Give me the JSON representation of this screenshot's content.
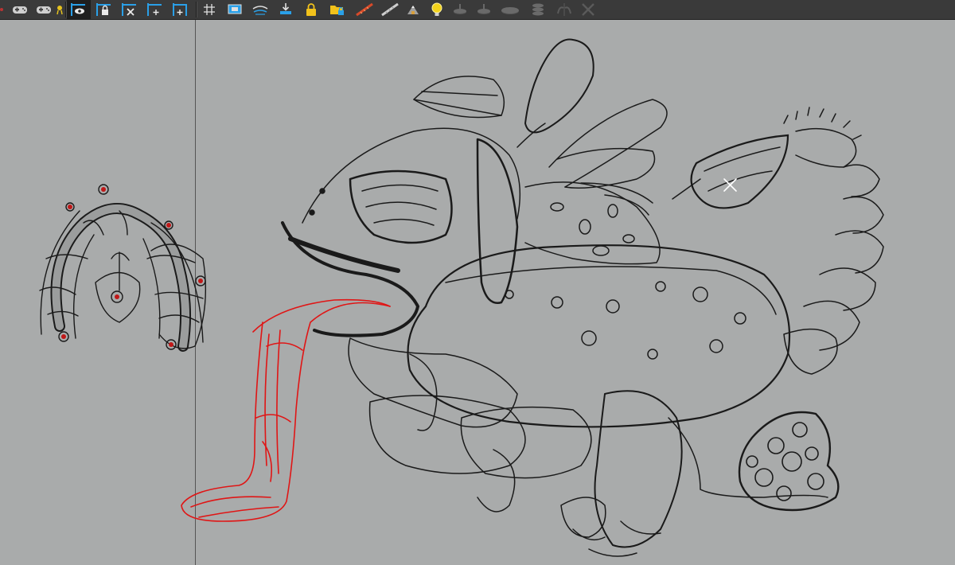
{
  "app": {
    "toolbar": {
      "tools": [
        {
          "name": "gamepad-left-icon"
        },
        {
          "name": "gamepad-right-icon"
        },
        {
          "name": "award-icon"
        },
        {
          "name": "frame-visibility-icon",
          "active": true
        },
        {
          "name": "frame-lock-icon"
        },
        {
          "name": "frame-clear-icon"
        },
        {
          "name": "frame-add-icon"
        },
        {
          "name": "frame-add-after-icon"
        },
        {
          "name": "grid-icon"
        },
        {
          "name": "display-icon"
        },
        {
          "name": "onion-skin-icon"
        },
        {
          "name": "import-icon"
        },
        {
          "name": "padlock-icon"
        },
        {
          "name": "folder-lock-icon"
        },
        {
          "name": "ruler-red-icon"
        },
        {
          "name": "ruler-white-icon"
        },
        {
          "name": "mountain-icon"
        },
        {
          "name": "lightbulb-icon"
        },
        {
          "name": "disc-1-icon"
        },
        {
          "name": "disc-2-icon"
        },
        {
          "name": "disc-3-icon"
        },
        {
          "name": "disc-stack-icon"
        },
        {
          "name": "mirror-icon"
        },
        {
          "name": "windmill-icon"
        }
      ]
    },
    "canvas": {
      "background": "#a9abab",
      "ink_color": "#1a1a1a",
      "highlight_color": "#e01515",
      "guide_color": "#555555"
    },
    "accent": "#2aa0e8"
  }
}
